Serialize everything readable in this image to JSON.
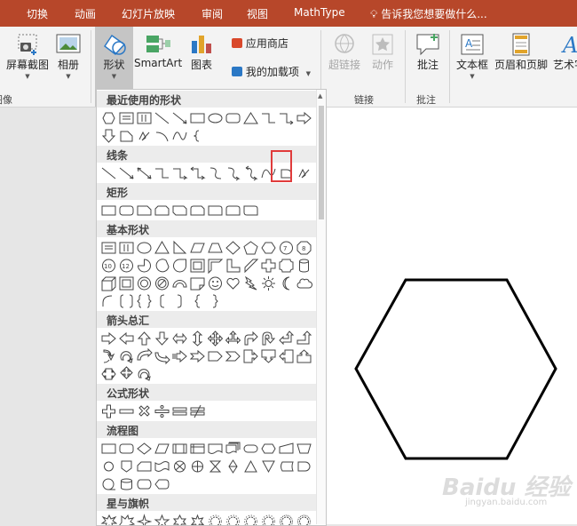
{
  "tabs": [
    "切换",
    "动画",
    "幻灯片放映",
    "审阅",
    "视图",
    "MathType"
  ],
  "tell_me": "告诉我您想要做什么...",
  "ribbon": {
    "screenshot": "屏幕截图",
    "album": "相册",
    "shapes": "形状",
    "smartart": "SmartArt",
    "chart": "图表",
    "app_store": "应用商店",
    "my_addins": "我的加载项",
    "hyperlink": "超链接",
    "action": "动作",
    "comment": "批注",
    "textbox": "文本框",
    "header_footer": "页眉和页脚",
    "wordart": "艺术字",
    "group_image_partial": "图像",
    "group_links": "链接",
    "group_comments": "批注"
  },
  "gallery": {
    "sections": [
      "最近使用的形状",
      "线条",
      "矩形",
      "基本形状",
      "箭头总汇",
      "公式形状",
      "流程图",
      "星与旗帜"
    ]
  },
  "watermark": {
    "logo": "Baidu 经验",
    "url": "jingyan.baidu.com"
  }
}
